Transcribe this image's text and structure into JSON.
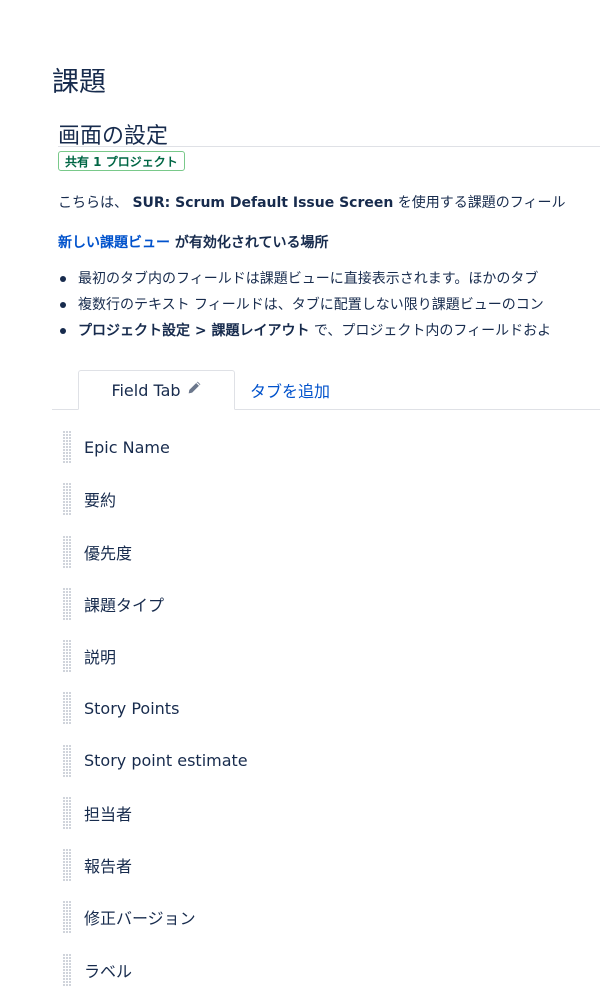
{
  "page": {
    "title": "課題"
  },
  "screen": {
    "section_title": "画面の設定",
    "badge": "共有 1 プロジェクト",
    "description": {
      "prefix": "こちらは、 ",
      "screen_name": "SUR: Scrum Default Issue Screen",
      "suffix": " を使用する課題のフィール"
    },
    "issue_view": {
      "link_text": "新しい課題ビュー",
      "rest_text": " が有効化されている場所"
    },
    "bullets": [
      {
        "text": "最初のタブ内のフィールドは課題ビューに直接表示されます。ほかのタブ"
      },
      {
        "text": "複数行のテキスト フィールドは、タブに配置しない限り課題ビューのコン"
      },
      {
        "bold": "プロジェクト設定 > 課題レイアウト",
        "text": " で、プロジェクト内のフィールドおよ"
      }
    ]
  },
  "tabs": {
    "active_label": "Field Tab",
    "add_label": "タブを追加"
  },
  "fields": [
    {
      "label": "Epic Name"
    },
    {
      "label": "要約"
    },
    {
      "label": "優先度"
    },
    {
      "label": "課題タイプ"
    },
    {
      "label": "説明"
    },
    {
      "label": "Story Points"
    },
    {
      "label": "Story point estimate"
    },
    {
      "label": "担当者"
    },
    {
      "label": "報告者"
    },
    {
      "label": "修正バージョン"
    },
    {
      "label": "ラベル"
    }
  ],
  "colors": {
    "text": "#172b4d",
    "link": "#0052cc",
    "badge_border": "#79c98a",
    "badge_text": "#006644"
  }
}
